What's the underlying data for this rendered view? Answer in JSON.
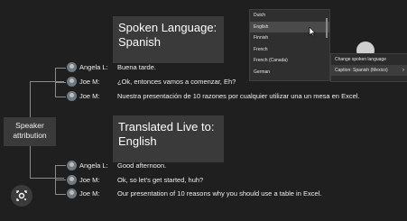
{
  "titles": {
    "spoken": "Spoken Language:\nSpanish",
    "translated": "Translated Live to:\nEnglish"
  },
  "speaker_attribution": "Speaker\nattribution",
  "spanish_transcript": [
    {
      "speaker": "Angela L:",
      "text": "Buena tarde."
    },
    {
      "speaker": "Joe M:",
      "text": "¿Ok, entonces vamos a comenzar, Eh?"
    },
    {
      "speaker": "Joe M:",
      "text": "Nuestra presentación de 10 razones por cualquier utilizar una un mesa en Excel."
    }
  ],
  "english_transcript": [
    {
      "speaker": "Angela L:",
      "text": "Good afternoon."
    },
    {
      "speaker": "Joe M:",
      "text": "Ok, so let's get started, huh?"
    },
    {
      "speaker": "Joe M:",
      "text": "Our presentation of 10 reasons why you should use a table in Excel."
    }
  ],
  "language_menu": {
    "items": [
      "Dutch",
      "English",
      "Finnish",
      "French",
      "French (Canada)",
      "German"
    ],
    "selected": "English"
  },
  "caption_menu": {
    "change_spoken": "Change spoken language",
    "caption_language": "Caption: Spanish (Mexico)"
  },
  "icons": {
    "avatar": "avatar-icon",
    "lens": "lens-icon",
    "cursor": "mouse-pointer-icon",
    "chevron": "chevron-right-icon"
  },
  "colors": {
    "background": "#1f1f1f",
    "panel": "#3a3a3a",
    "menu": "#2f2f2f",
    "text": "#f0f0f0"
  }
}
